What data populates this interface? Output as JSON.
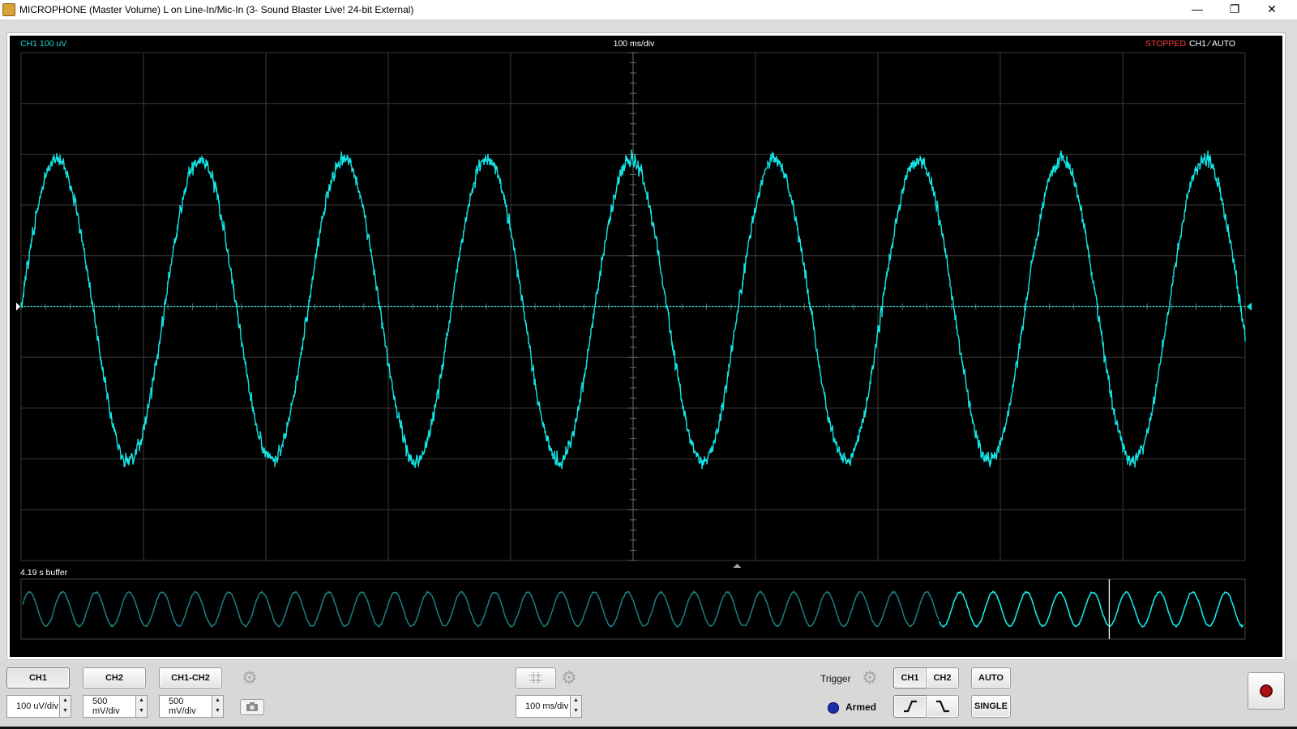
{
  "window": {
    "title": "MICROPHONE (Master Volume) L on Line-In/Mic-In (3- Sound Blaster Live! 24-bit External)",
    "minimize_glyph": "—",
    "restore_glyph": "❐",
    "close_glyph": "✕"
  },
  "scope": {
    "ch_label": "CH1 100 uV",
    "timebase_label": "100 ms/div",
    "status": "STOPPED",
    "trigger_info": "CH1 ⁄ AUTO",
    "buffer_label": "4.19 s buffer"
  },
  "controls": {
    "ch1": "CH1",
    "ch2": "CH2",
    "ch1_minus_ch2": "CH1-CH2",
    "ch1_scale": "100 uV/div",
    "ch2_scale": "500 mV/div",
    "math_scale": "500 mV/div",
    "time_scale": "100 ms/div",
    "trigger_label": "Trigger",
    "trig_ch1": "CH1",
    "trig_ch2": "CH2",
    "auto": "AUTO",
    "single": "SINGLE",
    "armed": "Armed"
  },
  "colors": {
    "trace": "#14e6e6",
    "stopped": "#ff3b3b",
    "label": "#22d5d5"
  }
}
